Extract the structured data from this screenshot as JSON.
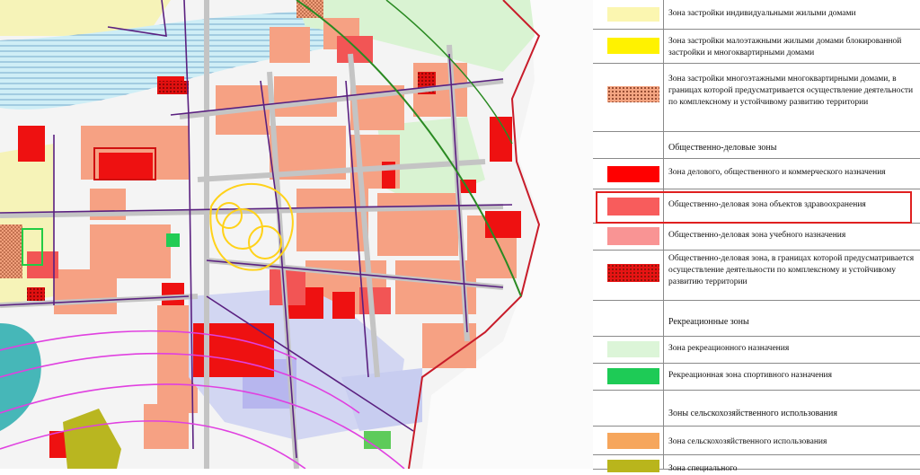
{
  "map": {
    "colors": {
      "river": "#cfeef6",
      "base": "#f2f2f2",
      "block": "#f7a386",
      "red_zone": "#ee1111",
      "health_zone": "#f25555",
      "edu_zone": "#f79a8a",
      "recreation": "#d9f5d4",
      "sport": "#22cc55",
      "industrial": "#b9b9ee",
      "roads": "#c7c7c7",
      "utilities": "#55227a",
      "boundary": "#c81c2a",
      "power_line": "#2a8a22",
      "arc": "#e040e0",
      "circle": "#ffd21a"
    }
  },
  "legend": {
    "rows": [
      {
        "text": "Зона застройки индивидуальными жилыми домами",
        "color": "#fbf6b0",
        "pattern": false
      },
      {
        "text": "Зона застройки малоэтажными жилыми домами блокированной застройки и многоквартирными домами",
        "color": "#fff200",
        "pattern": false
      },
      {
        "text": "Зона застройки многоэтажными многоквартирными домами, в границах которой предусматривается осуществление деятельности по комплексному и устойчивому развитию территории",
        "color": "#f4a582",
        "pattern": true
      },
      {
        "text": "Общественно-деловые зоны",
        "color": "",
        "pattern": false,
        "header": true
      },
      {
        "text": "Зона делового, общественного и коммерческого назначения",
        "color": "#ff0000",
        "pattern": false
      },
      {
        "text": "Общественно-деловая зона объектов здравоохранения",
        "color": "#f85c5c",
        "pattern": false
      },
      {
        "text": "Общественно-деловая зона учебного назначения",
        "color": "#f99494",
        "pattern": false
      },
      {
        "text": "Общественно-деловая зона, в границах которой предусматривается осуществление деятельности по комплексному и устойчивому развитию территории",
        "color": "#e81414",
        "pattern": true
      },
      {
        "text": "Рекреационные зоны",
        "color": "",
        "pattern": false,
        "header": true
      },
      {
        "text": "Зона рекреационного назначения",
        "color": "#dcf5d8",
        "pattern": false
      },
      {
        "text": "Рекреационная зона спортивного назначения",
        "color": "#1ecb56",
        "pattern": false
      },
      {
        "text": "Зоны сельскохозяйственного использования",
        "color": "",
        "pattern": false,
        "header": true
      },
      {
        "text": "Зона сельскохозяйственного использования",
        "color": "#f6a65c",
        "pattern": false
      },
      {
        "text": "Зона специального",
        "color": "#b9b51c",
        "pattern": false
      }
    ]
  }
}
